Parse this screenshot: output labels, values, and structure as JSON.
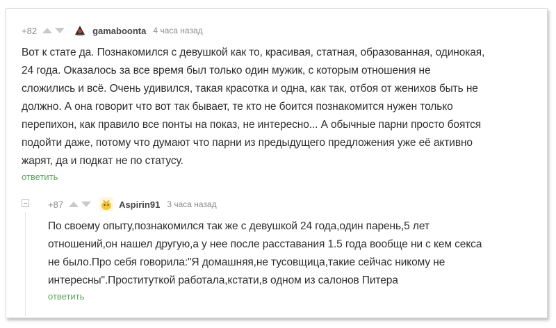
{
  "comment1": {
    "rating": "+82",
    "username": "gamaboonta",
    "time": "4 часа назад",
    "lines": [
      "Вот к стате да. Познакомился с девушкой как то, красивая, статная, образованная, одинокая,",
      "24 года. Оказалось за все время был только один мужик, с которым отношения не",
      "сложились и всё. Очень удивился, такая красотка и одна, как так, отбоя от женихов быть не",
      "должно. А она говорит что вот так бывает, те кто не боится познакомится нужен только",
      "перепихон, как правило все понты на показ, не интересно... А обычные парни просто боятся",
      "подойти даже, потому что думают что парни из предыдущего предложения уже её активно",
      "жарят, да и подкат не по статусу."
    ],
    "reply_label": "ответить"
  },
  "comment2": {
    "rating": "+87",
    "username": "Aspirin91",
    "time": "3 часа назад",
    "lines": [
      "По своему опыту,познакомился так же с девушкой 24 года,один парень,5 лет",
      "отношений,он нашел другую,а у нее после расставания 1.5 года вообще ни с кем секса",
      "не было.Про себя говорила:\"Я домашняя,не тусовщица,такие сейчас никому не",
      "интересны\".Проституткой работала,кстати,в одном из салонов Питера"
    ],
    "reply_label": "ответить"
  },
  "colors": {
    "reply": "#5aa55a",
    "meta": "#8a8a8a",
    "text": "#2d2d2d"
  },
  "icons": {
    "upvote": "arrow-up-icon",
    "downvote": "arrow-down-icon",
    "collapse": "minus-box-icon"
  }
}
